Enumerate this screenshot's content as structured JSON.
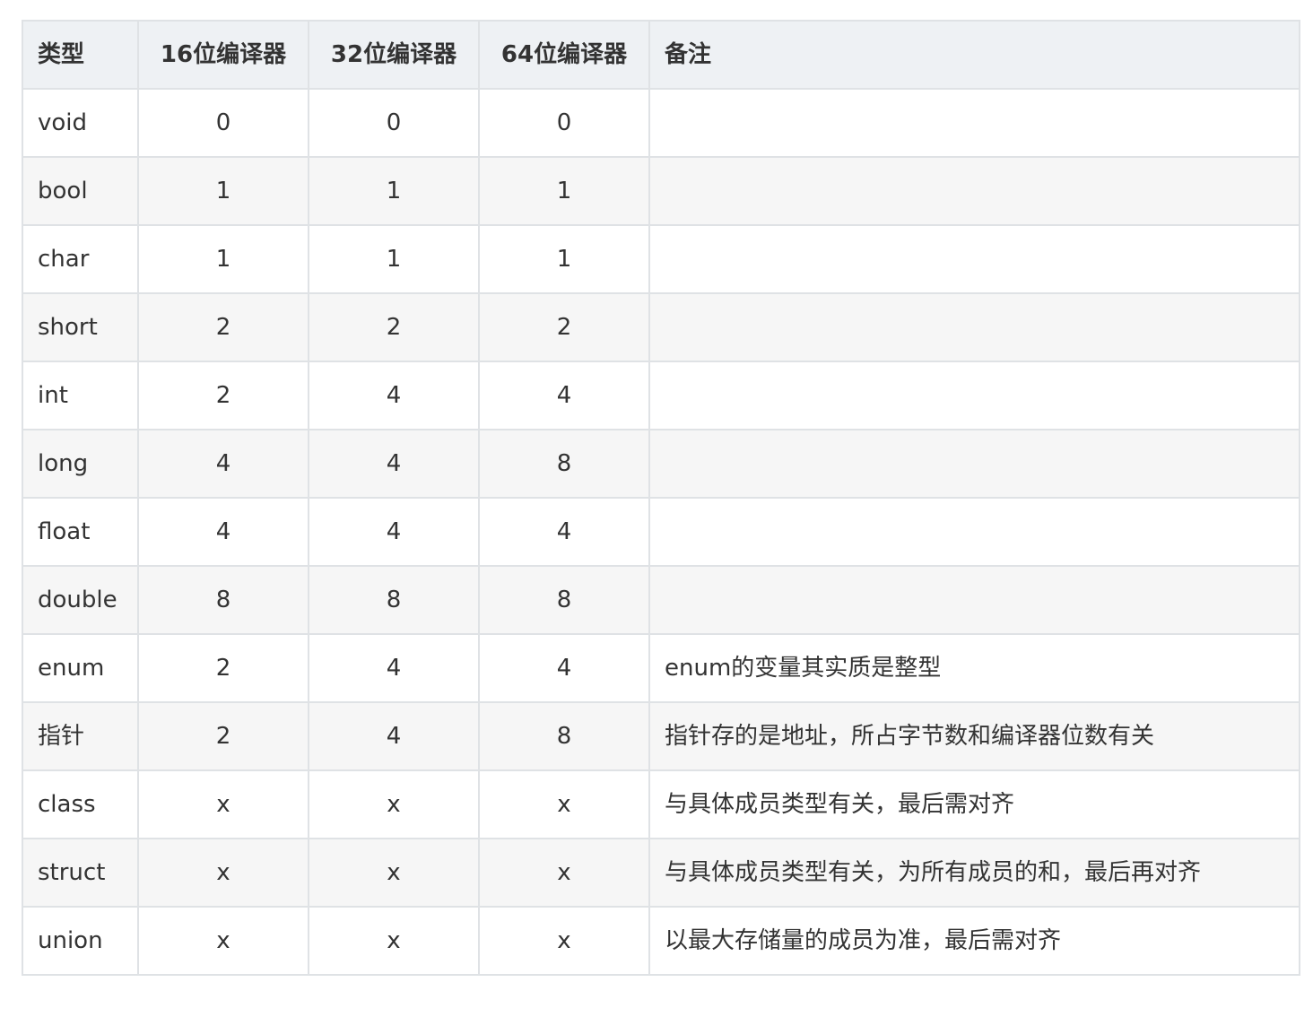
{
  "table": {
    "headers": [
      "类型",
      "16位编译器",
      "32位编译器",
      "64位编译器",
      "备注"
    ],
    "rows": [
      {
        "type": "void",
        "c16": "0",
        "c32": "0",
        "c64": "0",
        "note": ""
      },
      {
        "type": "bool",
        "c16": "1",
        "c32": "1",
        "c64": "1",
        "note": ""
      },
      {
        "type": "char",
        "c16": "1",
        "c32": "1",
        "c64": "1",
        "note": ""
      },
      {
        "type": "short",
        "c16": "2",
        "c32": "2",
        "c64": "2",
        "note": ""
      },
      {
        "type": "int",
        "c16": "2",
        "c32": "4",
        "c64": "4",
        "note": ""
      },
      {
        "type": "long",
        "c16": "4",
        "c32": "4",
        "c64": "8",
        "note": ""
      },
      {
        "type": "float",
        "c16": "4",
        "c32": "4",
        "c64": "4",
        "note": ""
      },
      {
        "type": "double",
        "c16": "8",
        "c32": "8",
        "c64": "8",
        "note": ""
      },
      {
        "type": "enum",
        "c16": "2",
        "c32": "4",
        "c64": "4",
        "note": "enum的变量其实质是整型"
      },
      {
        "type": "指针",
        "c16": "2",
        "c32": "4",
        "c64": "8",
        "note": "指针存的是地址，所占字节数和编译器位数有关"
      },
      {
        "type": "class",
        "c16": "x",
        "c32": "x",
        "c64": "x",
        "note": "与具体成员类型有关，最后需对齐"
      },
      {
        "type": "struct",
        "c16": "x",
        "c32": "x",
        "c64": "x",
        "note": "与具体成员类型有关，为所有成员的和，最后再对齐"
      },
      {
        "type": "union",
        "c16": "x",
        "c32": "x",
        "c64": "x",
        "note": "以最大存储量的成员为准，最后需对齐"
      }
    ]
  }
}
